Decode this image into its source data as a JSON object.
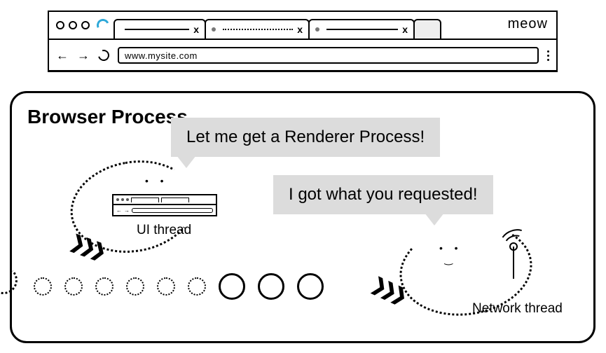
{
  "browser": {
    "brand": "meow",
    "address": "www.mysite.com",
    "tabs": [
      {
        "close": "x"
      },
      {
        "close": "x"
      },
      {
        "close": "x"
      }
    ]
  },
  "process": {
    "title": "Browser Process",
    "ui_thread": {
      "label": "UI thread",
      "speech": "Let me get a Renderer Process!"
    },
    "network_thread": {
      "label": "Network thread",
      "speech": "I got what you requested!"
    }
  }
}
